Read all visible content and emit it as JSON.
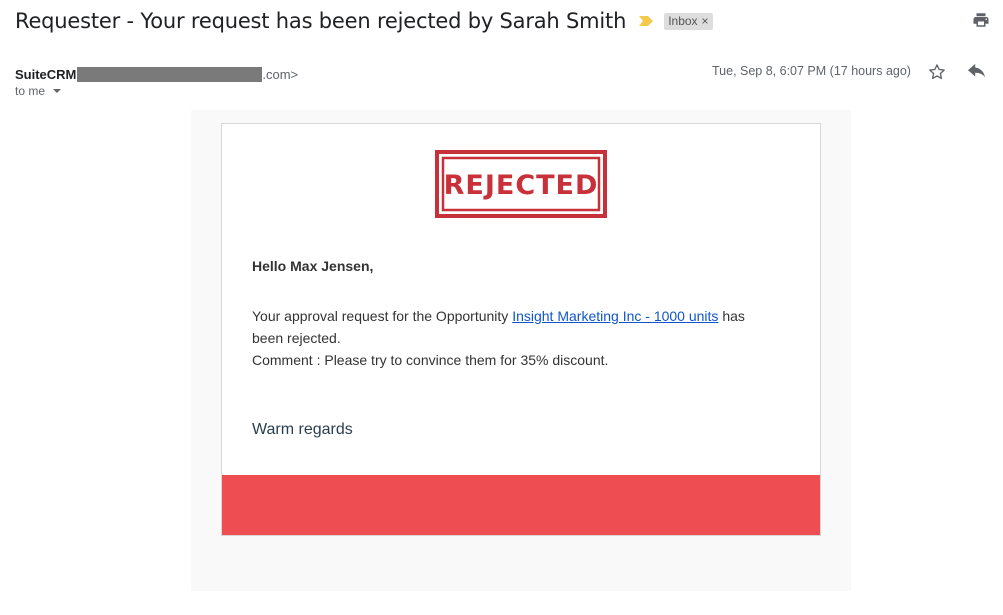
{
  "subject": "Requester - Your request has been rejected by Sarah Smith",
  "inbox_label": "Inbox",
  "chip_close": "×",
  "sender": {
    "name": "SuiteCRM",
    "domain_suffix": ".com>",
    "to_label": "to me"
  },
  "date": "Tue, Sep 8, 6:07 PM (17 hours ago)",
  "email": {
    "stamp_text": "REJECTED",
    "greeting": "Hello Max Jensen,",
    "body_prefix": "Your approval request for the Opportunity ",
    "link_text": "Insight Marketing Inc - 1000 units",
    "body_suffix": " has been rejected.",
    "comment": "Comment : Please try to convince them for 35% discount.",
    "regards": "Warm regards"
  },
  "colors": {
    "stamp": "#c8303a",
    "footer": "#ee4d52",
    "link": "#1155cc",
    "important_marker": "#f2c94c"
  },
  "icons": {
    "important": "important-marker-icon",
    "print": "print-icon",
    "star": "star-icon",
    "reply": "reply-icon",
    "dropdown": "chevron-down-icon"
  }
}
